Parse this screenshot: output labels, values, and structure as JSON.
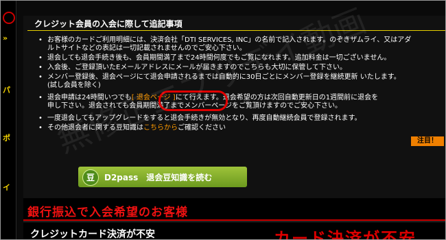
{
  "panel": {
    "title": "クレジット会員の入会に際して追記事項",
    "notes": [
      "お客様のカードご利用明細には、決済会社「DTI SERVICES, INC」の名前で記入されます。のぞきザムライ、又はアダ",
      "ルトサイトなどの表記は一切記載されませんのでご安心下さい。",
      "退会しても退会手続き後も、会員期間満了まで24時間何度でもご覧になれます。追加料金は一切ございません。",
      "入会後、ご登録頂いたEメールアドレスにメールが届きますのでこちらも大切に保管して下さい。",
      "メンバー登録後、退会ページにて退会申請されるまでは自動的に30日ごとにメンバー登録を継続更新 いたします。",
      "(試し会員を除く)",
      "退会申請は24時間いつでも",
      "にて行えます。退会希望の方は次回自動更新日の1週間前に退会を",
      "申し下さい。退会されても会員期間満了までメンバーページをご覧頂けますのでご安心下さい。",
      "一度退会してもアップグレードをすると退会手続きが無効となり、再度自動継続会員で登録されます。",
      "その他退会者に関する豆知識は",
      "ご確認ください"
    ],
    "links": {
      "taikai_page": "[ 退会ページ ]",
      "kochira": "こちらから"
    },
    "badge": "注目！",
    "cta": {
      "icon": "豆",
      "label": "D2pass　退会豆知識を読む"
    }
  },
  "watermark": "無修正エブリデイ動画",
  "bank": {
    "title": "銀行振込で入会希望のお客様"
  },
  "card": {
    "title": "クレジットカード決済が不安",
    "accent": "カード決済が不安"
  },
  "sidebar": {
    "mark1": "»",
    "mark2": "パ",
    "mark3": "ポ",
    "mark4": "イ"
  },
  "colors": {
    "accent_yellow": "#e7d000",
    "link_orange": "#ff9a00",
    "circle_red": "#e00000",
    "cta_green": "#7fb12a",
    "bank_red": "#e11111"
  }
}
